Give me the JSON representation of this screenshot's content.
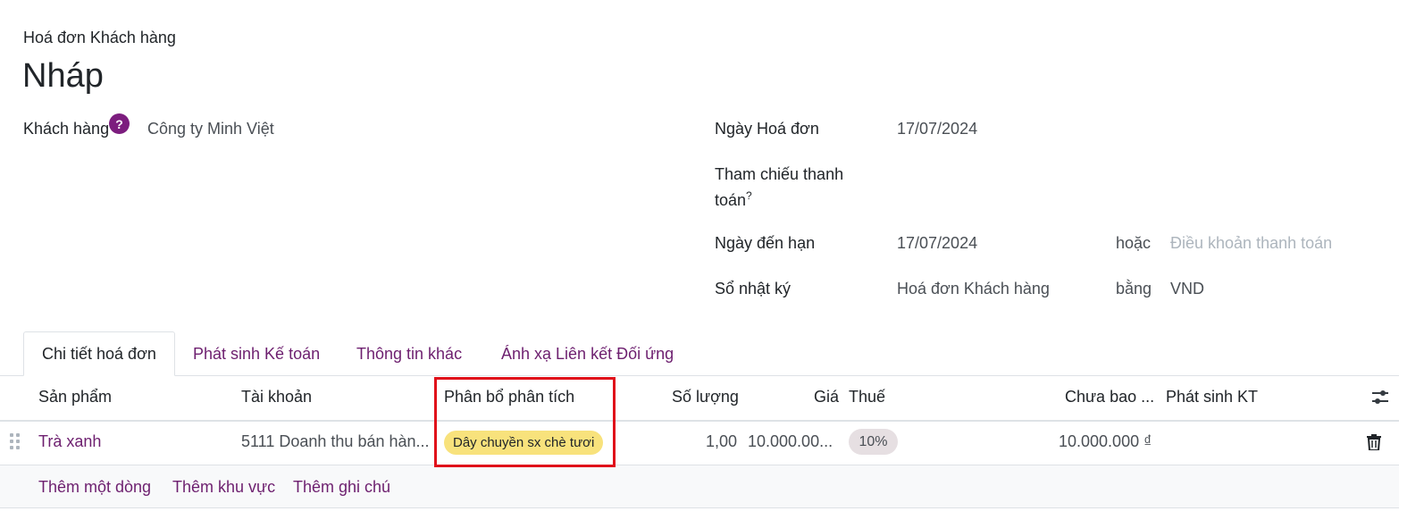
{
  "header": {
    "doc_type": "Hoá đơn Khách hàng",
    "status": "Nháp"
  },
  "form": {
    "customer_label": "Khách hàng",
    "customer_help": "?",
    "customer_value": "Công ty Minh Việt",
    "invoice_date_label": "Ngày Hoá đơn",
    "invoice_date_value": "17/07/2024",
    "payment_ref_label_line1": "Tham chiếu thanh",
    "payment_ref_label_line2": "toán",
    "payment_ref_help": "?",
    "due_date_label": "Ngày đến hạn",
    "due_date_value": "17/07/2024",
    "or_label": "hoặc",
    "payment_terms_placeholder": "Điều khoản thanh toán",
    "journal_label": "Sổ nhật ký",
    "journal_value": "Hoá đơn Khách hàng",
    "in_label": "bằng",
    "currency_value": "VND"
  },
  "tabs": [
    {
      "label": "Chi tiết hoá đơn",
      "active": true
    },
    {
      "label": "Phát sinh Kế toán"
    },
    {
      "label": "Thông tin khác"
    },
    {
      "label": "Ánh xạ Liên kết Đối ứng"
    }
  ],
  "table": {
    "headers": {
      "product": "Sản phẩm",
      "account": "Tài khoản",
      "analytic": "Phân bổ phân tích",
      "quantity": "Số lượng",
      "price": "Giá",
      "tax": "Thuế",
      "subtotal": "Chưa bao ...",
      "entries": "Phát sinh KT"
    },
    "rows": [
      {
        "product": "Trà xanh",
        "account": "5111 Doanh thu bán hàn...",
        "analytic": "Dây chuyền sx chè tươi",
        "quantity": "1,00",
        "price": "10.000.00...",
        "tax": "10%",
        "subtotal": "10.000.000 ₫"
      }
    ],
    "actions": {
      "add_line": "Thêm một dòng",
      "add_section": "Thêm khu vực",
      "add_note": "Thêm ghi chú"
    }
  },
  "colors": {
    "accent": "#6d1f6f",
    "help_badge": "#7c1d7e",
    "analytic_tag": "#f8e27c",
    "highlight": "#e0101a"
  }
}
